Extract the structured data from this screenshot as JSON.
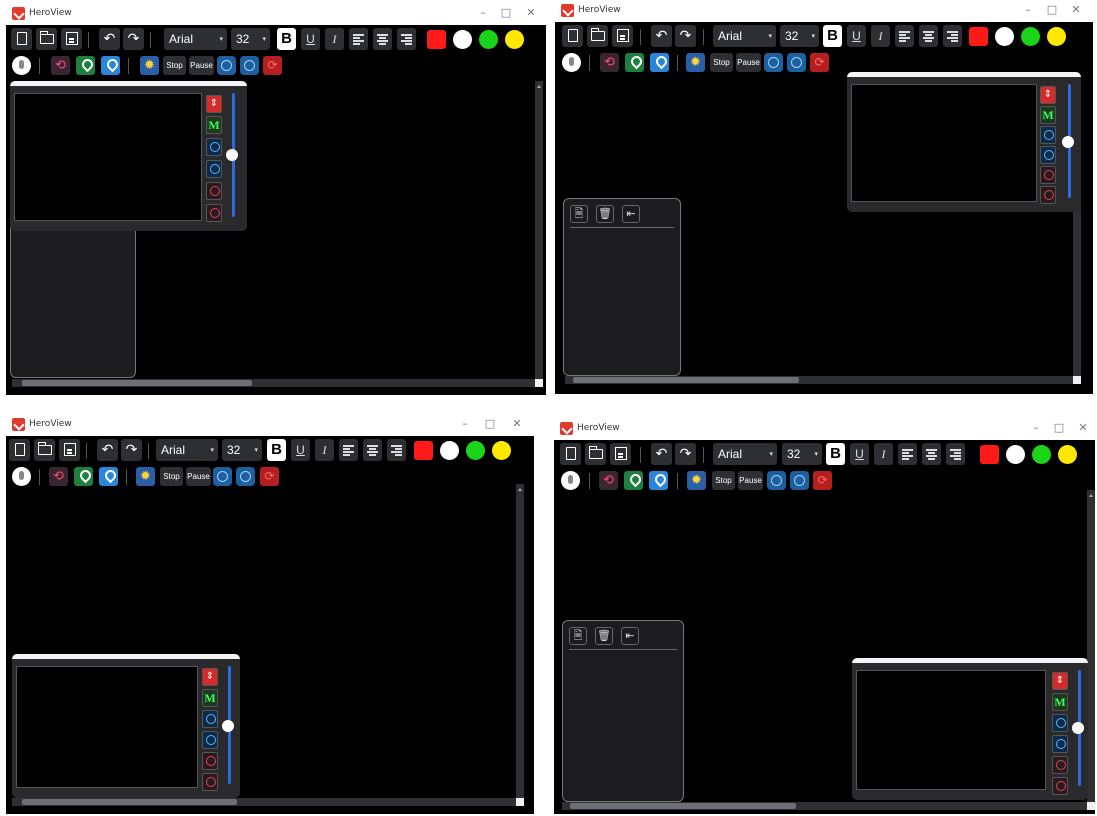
{
  "app": {
    "title": "HeroView",
    "min_glyph": "–",
    "max_glyph": "□",
    "close_glyph": "✕"
  },
  "toolbar": {
    "font_family": "Arial",
    "font_size": "32",
    "caret": "▾",
    "bold": "B",
    "underline": "U",
    "italic": "I",
    "undo_glyph": "↶",
    "redo_glyph": "↷",
    "stop_label": "Stop",
    "pause_label": "Pause",
    "refresh_glyph": "⟲",
    "gear_glyph": "✹",
    "reset_glyph": "⟳",
    "colors": [
      "#ff1a1a",
      "#ffffff",
      "#19d419",
      "#ffe800"
    ]
  },
  "side_panel": {
    "doc_glyph": "🗎",
    "trash_glyph": "🗑",
    "exit_glyph": "⇤"
  },
  "video": {
    "swap_glyph": "⇕",
    "m_label": "M"
  },
  "windows": [
    {
      "name": "top-left"
    },
    {
      "name": "top-right"
    },
    {
      "name": "bottom-left"
    },
    {
      "name": "bottom-right"
    }
  ]
}
